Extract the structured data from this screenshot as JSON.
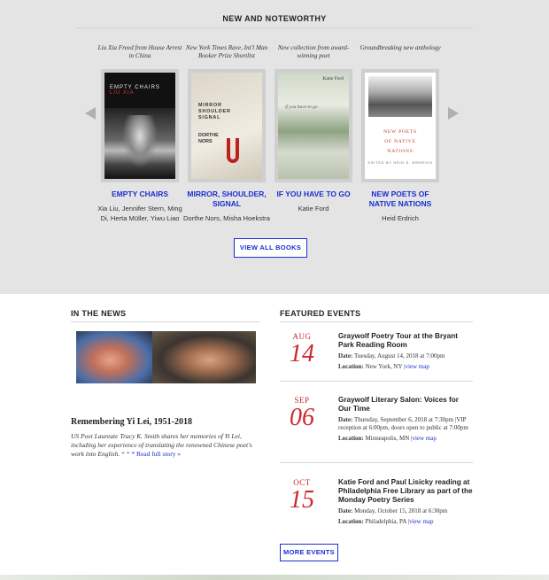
{
  "noteworthy": {
    "title": "NEW AND NOTEWORTHY",
    "books": [
      {
        "blurb": "Liu Xia Freed from House Arrest in China",
        "title": "EMPTY CHAIRS",
        "authors": "Xia Liu, Jennifer Stern, Ming Di, Herta Müller, Yiwu Liao",
        "cover_title": "EMPTY CHAIRS",
        "cover_author": "LIU XIA"
      },
      {
        "blurb": "New York Times Rave, Int'l Man Booker Prize Shortlist",
        "title": "MIRROR, SHOULDER, SIGNAL",
        "authors": "Dorthe Nors, Misha Hoekstra",
        "cover_title": "MIRROR SHOULDER SIGNAL",
        "cover_author": "DORTHE NORS"
      },
      {
        "blurb": "New collection from award-winning poet",
        "title": "IF YOU HAVE TO GO",
        "authors": "Katie Ford",
        "cover_title": "Katie Ford",
        "cover_author": "if you have to go"
      },
      {
        "blurb": "Groundbreaking new anthology",
        "title": "NEW POETS OF NATIVE NATIONS",
        "authors": "Heid Erdrich",
        "cover_title": "NEW POETS OF NATIVE NATIONS",
        "cover_author": "EDITED BY HEID E. ERDRICH"
      }
    ],
    "view_all": "VIEW ALL BOOKS"
  },
  "news": {
    "title": "IN THE NEWS",
    "headline": "Remembering Yi Lei, 1951-2018",
    "body": "US Poet Laureate Tracy K. Smith shares her memories of Yi Lei, including her experience of translating the renowned Chinese poet's work into English.",
    "dots": "*      *",
    "link": "* Read full story »"
  },
  "events": {
    "title": "FEATURED EVENTS",
    "items": [
      {
        "month": "AUG",
        "day": "14",
        "title": "Graywolf Poetry Tour at the Bryant Park Reading Room",
        "date_label": "Date:",
        "date": "Tuesday, August 14, 2018 at 7:00pm",
        "location_label": "Location:",
        "location": "New York, NY",
        "map": "view map"
      },
      {
        "month": "SEP",
        "day": "06",
        "title": "Graywolf Literary Salon: Voices for Our Time",
        "date_label": "Date:",
        "date": "Thursday, September 6, 2018 at 7:30pm |VIP reception at 6:00pm, doors open to public at 7:00pm",
        "location_label": "Location:",
        "location": "Minneapolis, MN",
        "map": "view map"
      },
      {
        "month": "OCT",
        "day": "15",
        "title": "Katie Ford and Paul Lisicky reading at Philadelphia Free Library as part of the Monday Poetry Series",
        "date_label": "Date:",
        "date": "Monday, October 15, 2018 at 6:30pm",
        "location_label": "Location:",
        "location": "Philadelphia, PA",
        "map": "view map"
      }
    ],
    "more": "MORE EVENTS"
  },
  "colors": {
    "accent_blue": "#1a2fd0",
    "event_red": "#d0262b",
    "top_bg": "#e4e4e4"
  }
}
